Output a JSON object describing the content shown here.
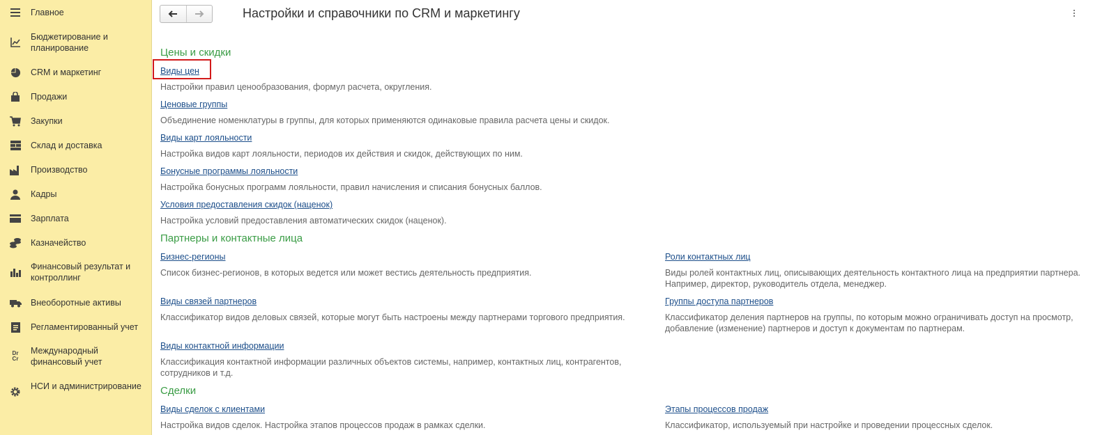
{
  "sidebar": {
    "items": [
      {
        "label": "Главное",
        "icon": "menu-lines-icon"
      },
      {
        "label": "Бюджетирование и планирование",
        "icon": "budget-chart-icon"
      },
      {
        "label": "CRM и маркетинг",
        "icon": "pie-chart-icon"
      },
      {
        "label": "Продажи",
        "icon": "shopping-bag-icon"
      },
      {
        "label": "Закупки",
        "icon": "cart-icon"
      },
      {
        "label": "Склад и доставка",
        "icon": "warehouse-grid-icon"
      },
      {
        "label": "Производство",
        "icon": "factory-icon"
      },
      {
        "label": "Кадры",
        "icon": "person-icon"
      },
      {
        "label": "Зарплата",
        "icon": "wallet-icon"
      },
      {
        "label": "Казначейство",
        "icon": "coins-icon"
      },
      {
        "label": "Финансовый результат и контроллинг",
        "icon": "bar-chart-icon"
      },
      {
        "label": "Внеоборотные активы",
        "icon": "truck-icon"
      },
      {
        "label": "Регламентированный учет",
        "icon": "report-icon"
      },
      {
        "label": "Международный финансовый учет",
        "icon": "dr-cr-icon",
        "icon_text": "Dr\nCr"
      },
      {
        "label": "НСИ и администрирование",
        "icon": "gear-icon"
      }
    ]
  },
  "toolbar": {
    "back_icon": "arrow-left-icon",
    "forward_icon": "arrow-right-icon",
    "more_icon": "more-vertical-icon"
  },
  "page": {
    "title": "Настройки и справочники по CRM и маркетингу"
  },
  "sections": {
    "prices": {
      "title": "Цены и скидки",
      "items": [
        {
          "link": "Виды цен",
          "desc": "Настройки правил ценообразования, формул расчета, округления."
        },
        {
          "link": "Ценовые группы",
          "desc": "Объединение номенклатуры в группы, для которых применяются одинаковые правила расчета цены и скидок."
        },
        {
          "link": "Виды карт лояльности",
          "desc": "Настройка видов карт лояльности, периодов их действия и скидок, действующих по ним."
        },
        {
          "link": "Бонусные программы лояльности",
          "desc": "Настройка бонусных программ лояльности, правил начисления и списания бонусных баллов."
        },
        {
          "link": "Условия предоставления скидок (наценок)",
          "desc": "Настройка условий предоставления автоматических скидок (наценок)."
        }
      ]
    },
    "partners": {
      "title": "Партнеры и контактные лица",
      "left": [
        {
          "link": "Бизнес-регионы",
          "desc": "Список бизнес-регионов, в которых ведется или может вестись деятельность предприятия."
        },
        {
          "link": "Виды связей партнеров",
          "desc": "Классификатор видов деловых связей, которые могут быть настроены между партнерами торгового предприятия."
        },
        {
          "link": "Виды контактной информации",
          "desc": "Классификация контактной информации различных объектов системы, например, контактных лиц, контрагентов, сотрудников и т.д."
        }
      ],
      "right": [
        {
          "link": "Роли контактных лиц",
          "desc": "Виды ролей контактных лиц, описывающих деятельность контактного лица на предприятии партнера. Например, директор, руководитель отдела, менеджер."
        },
        {
          "link": "Группы доступа партнеров",
          "desc": "Классификатор деления партнеров на группы, по которым можно ограничивать доступ на просмотр, добавление (изменение) партнеров и доступ к документам по партнерам."
        }
      ]
    },
    "deals": {
      "title": "Сделки",
      "left": [
        {
          "link": "Виды сделок с клиентами",
          "desc": "Настройка видов сделок. Настройка этапов процессов продаж в рамках сделки."
        }
      ],
      "right": [
        {
          "link": "Этапы процессов продаж",
          "desc": "Классификатор, используемый при настройке и проведении процессных сделок."
        }
      ]
    }
  },
  "colors": {
    "sidebar_bg": "#fbeda6",
    "section_title": "#3a9c45",
    "link": "#1c4e8a",
    "highlight": "#d21a1a"
  }
}
